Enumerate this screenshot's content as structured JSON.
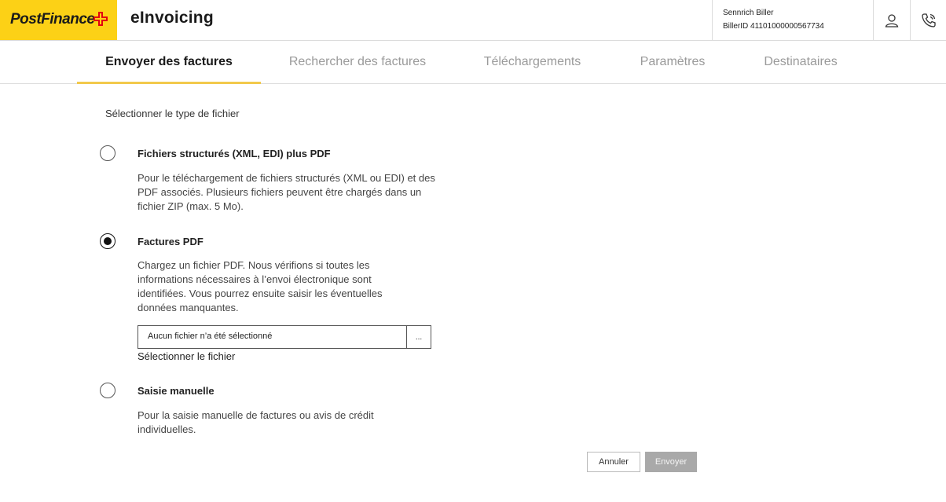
{
  "header": {
    "logo_text": "PostFinance",
    "app_title": "eInvoicing",
    "user_name": "Sennrich Biller",
    "biller_id": "BillerID 41101000000567734",
    "brand_color": "#fcd116",
    "logo_cross_color": "#e3000f"
  },
  "tabs": [
    {
      "label": "Envoyer des factures",
      "active": true
    },
    {
      "label": "Rechercher des factures",
      "active": false
    },
    {
      "label": "Téléchargements",
      "active": false
    },
    {
      "label": "Paramètres",
      "active": false
    },
    {
      "label": "Destinataires",
      "active": false
    }
  ],
  "form": {
    "section_title": "Sélectionner le type de fichier",
    "options": [
      {
        "title": "Fichiers structurés (XML, EDI) plus PDF",
        "description": "Pour le téléchargement de fichiers structurés (XML ou EDI) et des PDF associés. Plusieurs fichiers peuvent être chargés dans un fichier ZIP (max. 5 Mo).",
        "selected": false
      },
      {
        "title": "Factures PDF",
        "description": "Chargez un fichier PDF. Nous vérifions si toutes les informations nécessaires à l’envoi électronique sont identifiées. Vous pourrez ensuite saisir les éventuelles données manquantes.",
        "selected": true
      },
      {
        "title": "Saisie manuelle",
        "description": "Pour la saisie manuelle de factures ou avis de crédit individuelles.",
        "selected": false
      }
    ],
    "file_input": {
      "value": "Aucun fichier n’a été sélectionné",
      "browse_label": "...",
      "label": "Sélectionner le fichier"
    },
    "cancel_label": "Annuler",
    "send_label": "Envoyer"
  },
  "icons": {
    "user": "user-icon",
    "phone": "phone-icon"
  }
}
